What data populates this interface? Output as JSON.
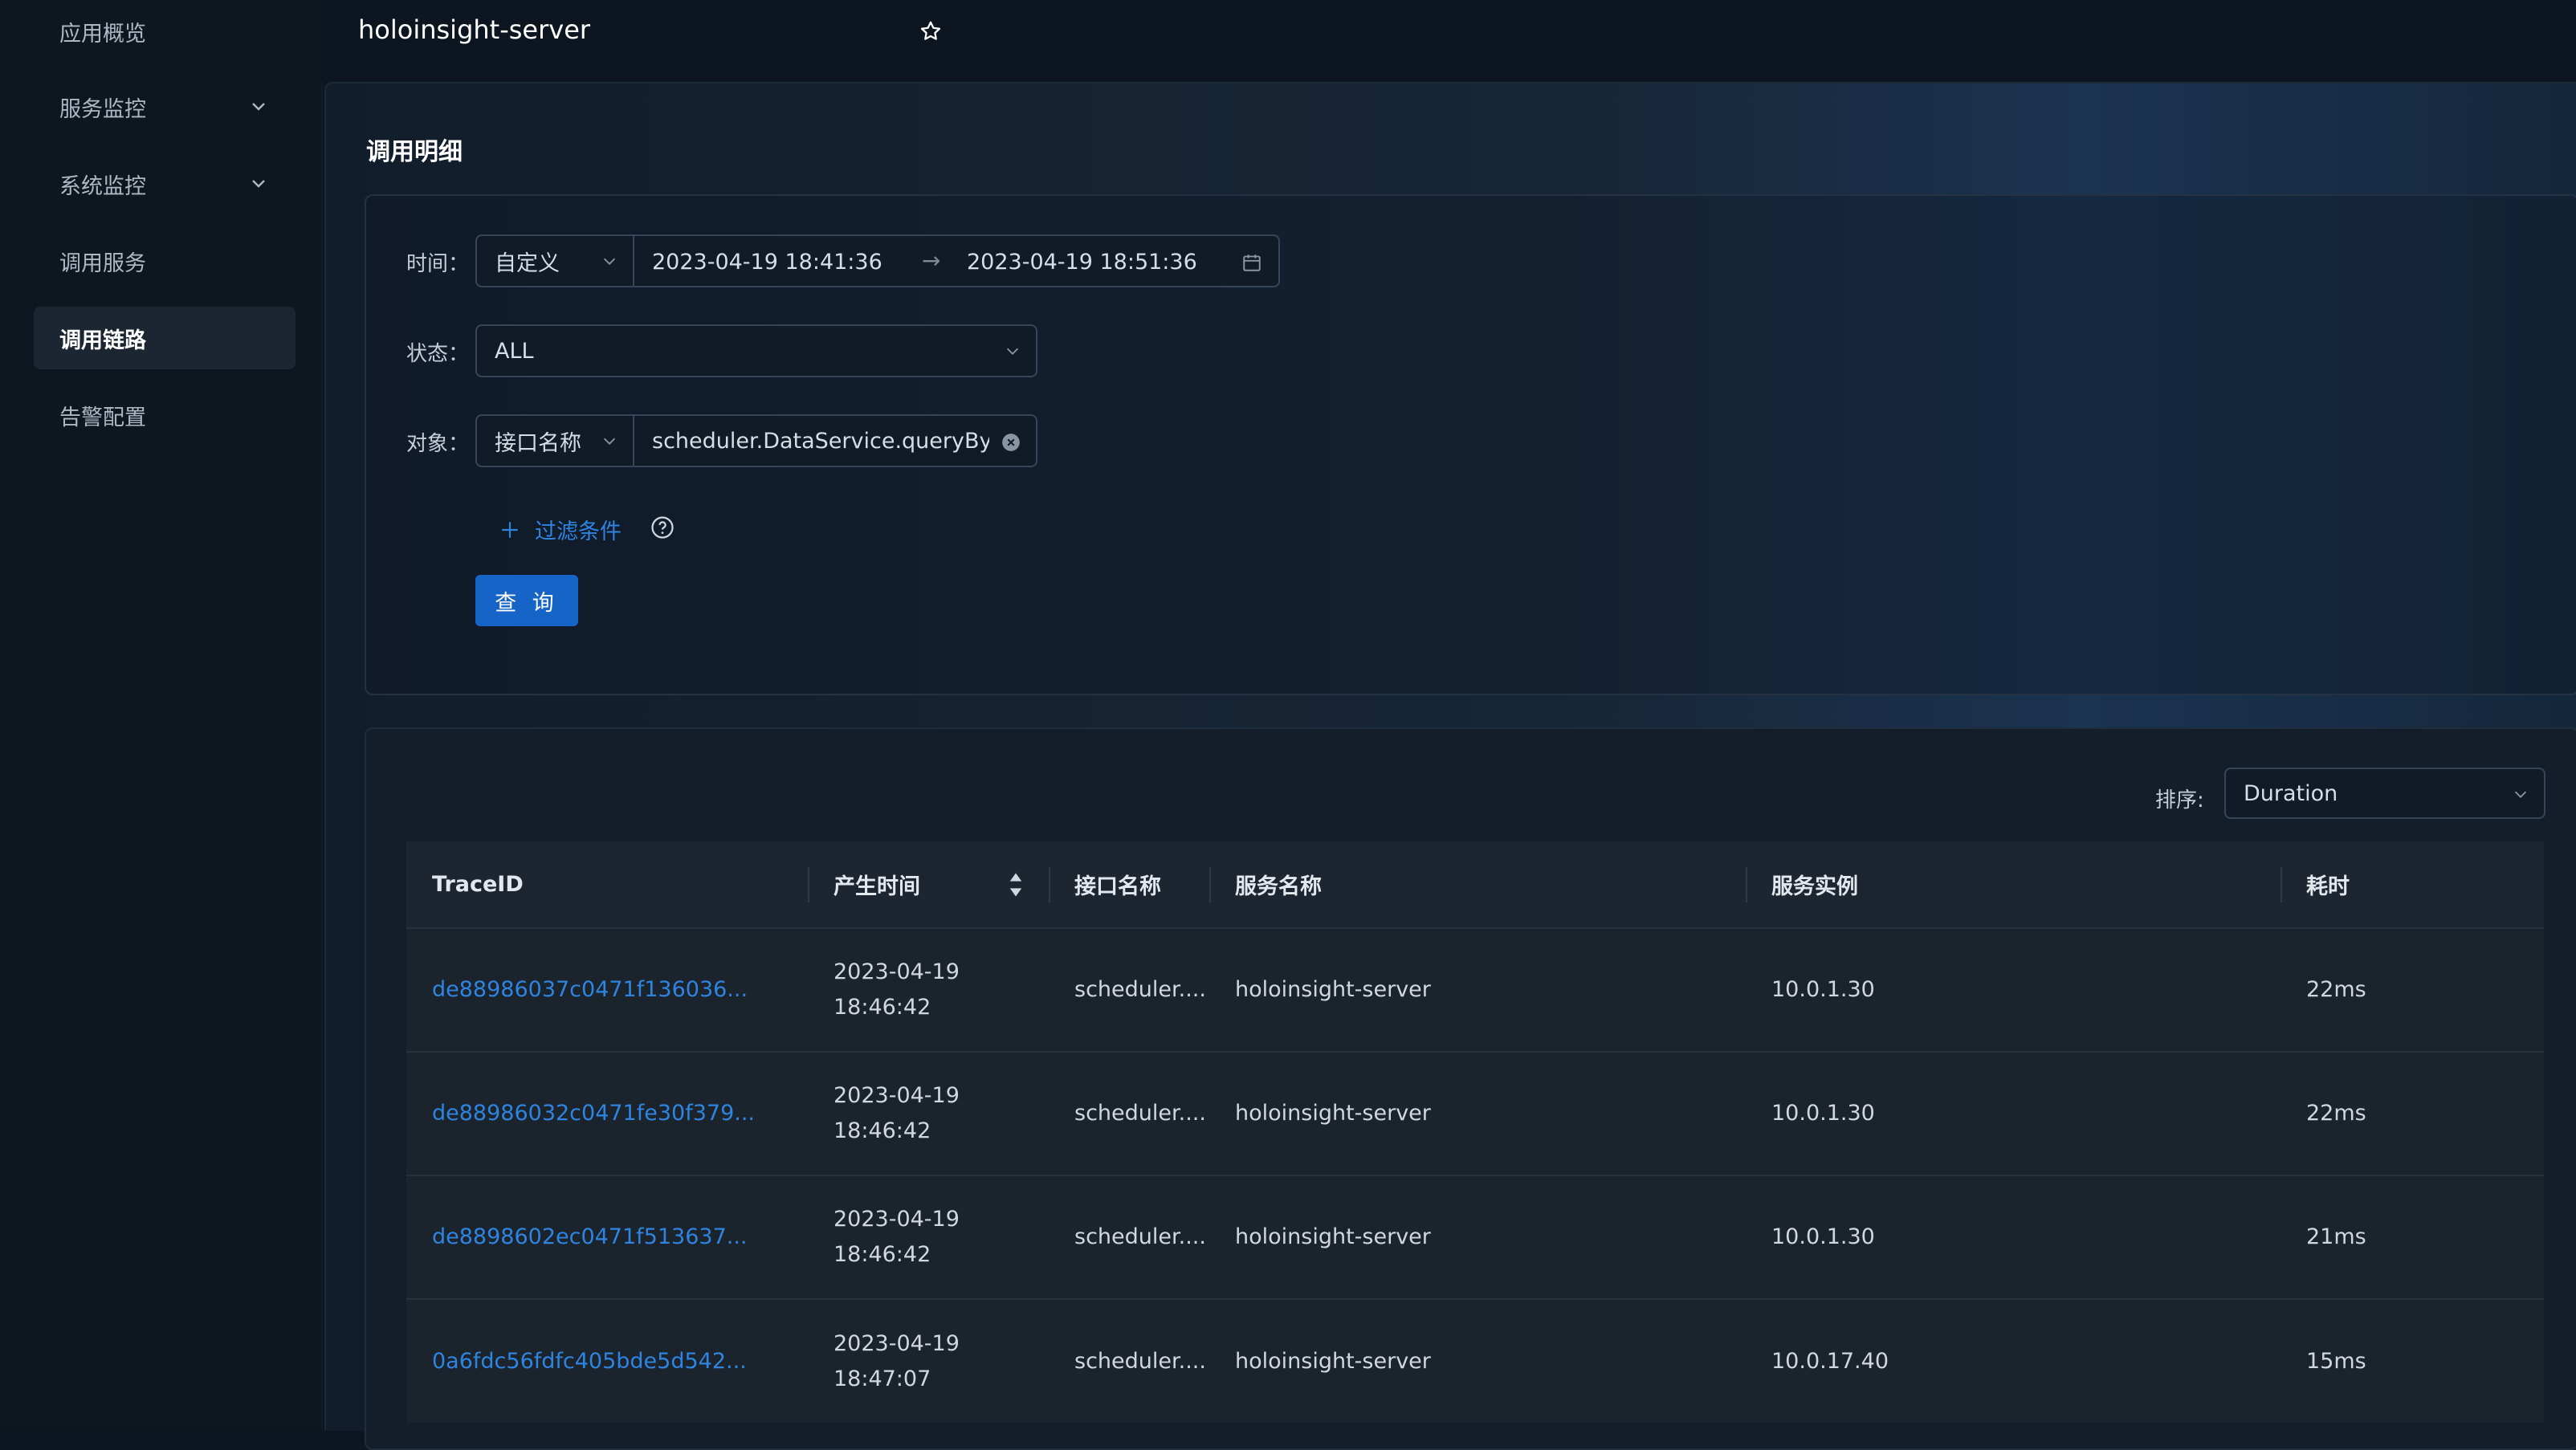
{
  "sidebar": {
    "items": [
      {
        "label": "应用概览"
      },
      {
        "label": "服务监控"
      },
      {
        "label": "系统监控"
      },
      {
        "label": "调用服务"
      },
      {
        "label": "调用链路"
      },
      {
        "label": "告警配置"
      }
    ]
  },
  "header": {
    "title": "holoinsight-server"
  },
  "section": {
    "title": "调用明细"
  },
  "filter": {
    "time_label": "时间：",
    "time_mode": "自定义",
    "start": "2023-04-19 18:41:36",
    "arrow": "→",
    "end": "2023-04-19 18:51:36",
    "status_label": "状态：",
    "status_value": "ALL",
    "object_label": "对象：",
    "object_type": "接口名称",
    "object_value": "scheduler.DataService.queryByE",
    "add_filter": "过滤条件",
    "query_button": "查 询"
  },
  "results": {
    "sort_label": "排序:",
    "sort_value": "Duration",
    "columns": [
      "TraceID",
      "产生时间",
      "接口名称",
      "服务名称",
      "服务实例",
      "耗时"
    ],
    "rows": [
      {
        "trace": "de88986037c0471f136036...",
        "date": "2023-04-19",
        "time": "18:46:42",
        "endpoint": "scheduler....",
        "service": "holoinsight-server",
        "instance": "10.0.1.30",
        "duration": "22ms"
      },
      {
        "trace": "de88986032c0471fe30f379...",
        "date": "2023-04-19",
        "time": "18:46:42",
        "endpoint": "scheduler....",
        "service": "holoinsight-server",
        "instance": "10.0.1.30",
        "duration": "22ms"
      },
      {
        "trace": "de8898602ec0471f513637...",
        "date": "2023-04-19",
        "time": "18:46:42",
        "endpoint": "scheduler....",
        "service": "holoinsight-server",
        "instance": "10.0.1.30",
        "duration": "21ms"
      },
      {
        "trace": "0a6fdc56fdfc405bde5d542...",
        "date": "2023-04-19",
        "time": "18:47:07",
        "endpoint": "scheduler....",
        "service": "holoinsight-server",
        "instance": "10.0.17.40",
        "duration": "15ms"
      }
    ]
  }
}
